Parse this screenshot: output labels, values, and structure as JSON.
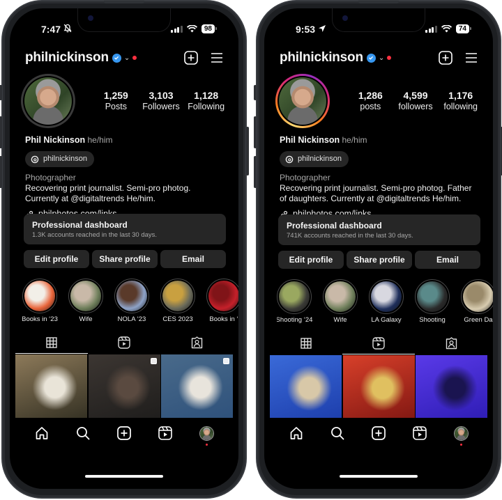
{
  "phones": [
    {
      "status": {
        "time": "7:47",
        "time_icon": "bell-slash-icon",
        "battery": "98"
      },
      "header": {
        "username": "philnickinson",
        "verified": true
      },
      "avatar_ring": "plain",
      "stats": [
        {
          "value": "1,259",
          "label": "Posts"
        },
        {
          "value": "3,103",
          "label": "Followers"
        },
        {
          "value": "1,128",
          "label": "Following"
        }
      ],
      "profile": {
        "name": "Phil Nickinson",
        "pronouns": "he/him",
        "threads_handle": "philnickinson",
        "category": "Photographer",
        "bio": "Recovering print journalist. Semi-pro photog. Currently at @digitaltrends He/him.",
        "link": "philphotos.com/links"
      },
      "dashboard": {
        "title": "Professional dashboard",
        "subtitle": "1.3K accounts reached in the last 30 days."
      },
      "buttons": {
        "edit": "Edit profile",
        "share": "Share profile",
        "email": "Email"
      },
      "highlights": [
        {
          "label": "Books in ‘23",
          "colors": [
            "#e8643a",
            "#f2efe8"
          ]
        },
        {
          "label": "Wife",
          "colors": [
            "#6e7e5a",
            "#c9b9a8"
          ]
        },
        {
          "label": "NOLA ‘23",
          "colors": [
            "#8ea3c8",
            "#5a3a2a"
          ]
        },
        {
          "label": "CES 2023",
          "colors": [
            "#6a6a5a",
            "#c9a040"
          ]
        },
        {
          "label": "Books in ‘",
          "colors": [
            "#c5202a",
            "#801418"
          ]
        }
      ],
      "active_tab": "grid",
      "posts": [
        {
          "colors": [
            "#2c2a1e",
            "#8d7a5a",
            "#e9e4d8"
          ],
          "multi": false
        },
        {
          "colors": [
            "#1c1b1a",
            "#3c3632",
            "#5a4a40"
          ],
          "multi": true
        },
        {
          "colors": [
            "#2c4f7a",
            "#496a8a",
            "#e8e4dc"
          ],
          "multi": true
        },
        {
          "colors": [
            "#c8ccd2",
            "#e0e0e0",
            "#8a6a50"
          ],
          "multi": true
        },
        {
          "colors": [
            "#2a2a22",
            "#c8a890",
            "#1a1a18"
          ],
          "multi": false
        },
        {
          "colors": [
            "#2e4a22",
            "#4a6a30",
            "#1e3418"
          ],
          "multi": false
        }
      ]
    },
    {
      "status": {
        "time": "9:53",
        "time_icon": "location-arrow-icon",
        "battery": "74"
      },
      "header": {
        "username": "philnickinson",
        "verified": true
      },
      "avatar_ring": "story",
      "stats": [
        {
          "value": "1,286",
          "label": "posts"
        },
        {
          "value": "4,599",
          "label": "followers"
        },
        {
          "value": "1,176",
          "label": "following"
        }
      ],
      "profile": {
        "name": "Phil Nickinson",
        "pronouns": "he/him",
        "threads_handle": "philnickinson",
        "category": "Photographer",
        "bio": "Recovering print journalist. Semi-pro photog. Father of daughters. Currently at @digitaltrends He/him.",
        "link": "philphotos.com/links"
      },
      "dashboard": {
        "title": "Professional dashboard",
        "subtitle": "741K accounts reached in the last 30 days."
      },
      "buttons": {
        "edit": "Edit profile",
        "share": "Share profile",
        "email": "Email"
      },
      "highlights": [
        {
          "label": "Shooting ‘24",
          "colors": [
            "#3a3a36",
            "#9aa860"
          ]
        },
        {
          "label": "Wife",
          "colors": [
            "#6e7e5a",
            "#c9b9a8"
          ]
        },
        {
          "label": "LA Galaxy",
          "colors": [
            "#1e2e5a",
            "#d8d8e0"
          ]
        },
        {
          "label": "Shooting",
          "colors": [
            "#2a2a2a",
            "#5a8a8a"
          ]
        },
        {
          "label": "Green Da",
          "colors": [
            "#d8ccb0",
            "#9a8a6a"
          ]
        }
      ],
      "active_tab": "reels",
      "posts": [
        {
          "colors": [
            "#1a3aa8",
            "#3a6ad8",
            "#d8c8a8"
          ],
          "multi": false
        },
        {
          "colors": [
            "#7a1410",
            "#d8402a",
            "#e0c060"
          ],
          "multi": false
        },
        {
          "colors": [
            "#2a1ab0",
            "#5a3ae8",
            "#1a1450"
          ],
          "multi": false
        }
      ]
    }
  ],
  "nav": [
    "home-icon",
    "search-icon",
    "create-icon",
    "reels-icon",
    "profile-avatar"
  ]
}
